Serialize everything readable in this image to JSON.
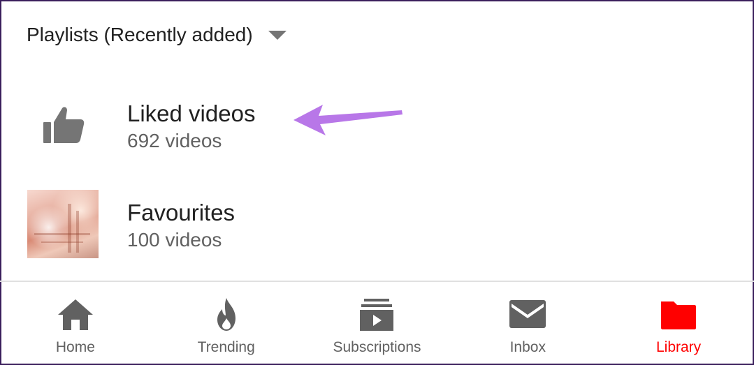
{
  "header": {
    "sort_label": "Playlists (Recently added)"
  },
  "playlists": [
    {
      "title": "Liked videos",
      "count_text": "692 videos",
      "icon": "thumbs-up-icon"
    },
    {
      "title": "Favourites",
      "count_text": "100 videos",
      "icon": "playlist-thumbnail"
    }
  ],
  "annotation": {
    "arrow_color": "#b877e8"
  },
  "bottom_nav": {
    "items": [
      {
        "label": "Home",
        "icon": "home-icon",
        "active": false
      },
      {
        "label": "Trending",
        "icon": "flame-icon",
        "active": false
      },
      {
        "label": "Subscriptions",
        "icon": "subscriptions-icon",
        "active": false
      },
      {
        "label": "Inbox",
        "icon": "mail-icon",
        "active": false
      },
      {
        "label": "Library",
        "icon": "folder-icon",
        "active": true
      }
    ]
  },
  "colors": {
    "icon_gray": "#757575",
    "active_red": "#ff0000",
    "text_primary": "#212121",
    "text_secondary": "#616161"
  }
}
